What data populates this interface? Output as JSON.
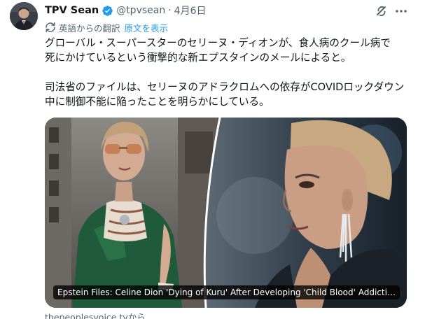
{
  "author": {
    "display_name": "TPV Sean",
    "handle": "@tpvsean",
    "separator": "·",
    "date": "4月6日"
  },
  "translation": {
    "label": "英語からの翻訳",
    "show_original": "原文を表示"
  },
  "tweet": {
    "paragraph_1": "グローバル・スーパースターのセリーヌ・ディオンが、食人病のクール病で\n死にかけているという衝撃的な新エプスタインのメールによると。",
    "paragraph_2": "司法省のファイルは、セリーヌのアドラクロムへの依存がCOVIDロックダウン\n中に制御不能に陥ったことを明らかにしている。"
  },
  "link_card": {
    "caption": "Epstein Files: Celine Dion 'Dying of Kuru' After Developing 'Child Blood' Addictio...",
    "source": "thepeoplesvoice.tvから"
  },
  "icons": {
    "verified": "verified-badge-icon",
    "grok": "grok-icon",
    "more": "more-options-icon",
    "translate": "translate-icon"
  },
  "colors": {
    "text": "#0f1419",
    "secondary": "#536471",
    "link": "#1d9bf0",
    "verified": "#1d9bf0"
  }
}
